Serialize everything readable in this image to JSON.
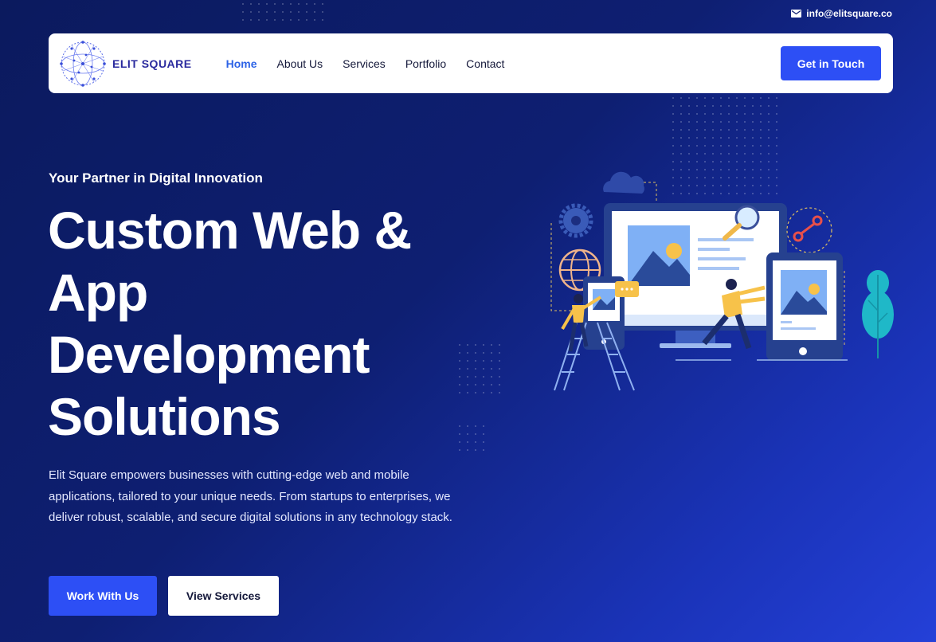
{
  "topbar": {
    "email": "info@elitsquare.co",
    "email_icon": "mail-icon"
  },
  "header": {
    "logo_text": "ELIT SQUARE",
    "nav": [
      {
        "label": "Home",
        "active": true
      },
      {
        "label": "About Us",
        "active": false
      },
      {
        "label": "Services",
        "active": false
      },
      {
        "label": "Portfolio",
        "active": false
      },
      {
        "label": "Contact",
        "active": false
      }
    ],
    "cta_label": "Get in Touch"
  },
  "hero": {
    "eyebrow": "Your Partner in Digital Innovation",
    "title_lines": [
      "Custom Web &",
      "App",
      "Development",
      "Solutions"
    ],
    "description": "Elit Square empowers businesses with cutting-edge web and mobile applications, tailored to your unique needs. From startups to enterprises, we deliver robust, scalable, and secure digital solutions in any technology stack.",
    "primary_button": "Work With Us",
    "secondary_button": "View Services"
  },
  "colors": {
    "accent": "#2d4ff5",
    "nav_active": "#2d63e6",
    "background_start": "#0b1a5e",
    "background_end": "#2440d8"
  }
}
